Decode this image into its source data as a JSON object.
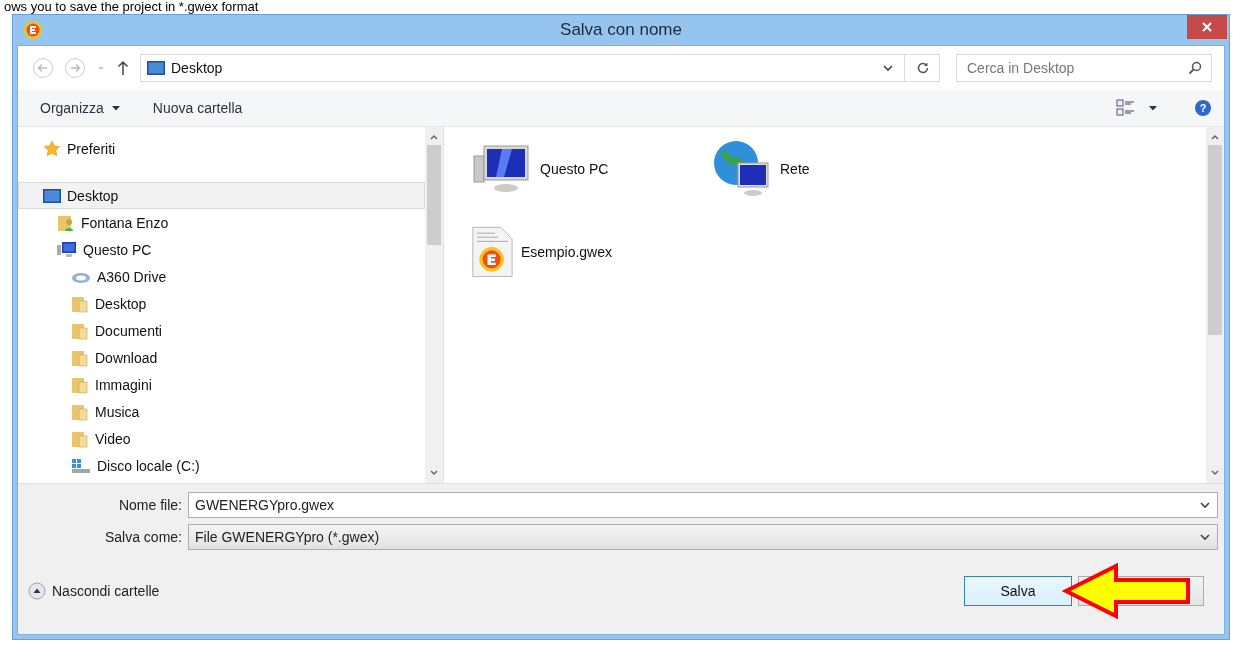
{
  "caption": "ows you to save the project in *.gwex format",
  "window": {
    "title": "Salva con nome"
  },
  "address_bar": {
    "path": "Desktop"
  },
  "search": {
    "placeholder": "Cerca in Desktop"
  },
  "toolbar": {
    "items": [
      "Organizza",
      "Nuova cartella"
    ],
    "help": "?"
  },
  "nav": {
    "items": [
      {
        "label": "Preferiti",
        "kind": "star",
        "selected": false
      },
      {
        "label": "Desktop",
        "kind": "desktop",
        "selected": true,
        "children": [
          {
            "label": "Fontana Enzo",
            "kind": "user",
            "selected": false
          },
          {
            "label": "Questo PC",
            "kind": "computer",
            "selected": false,
            "children": [
              {
                "label": "A360 Drive",
                "kind": "cloud",
                "selected": false
              },
              {
                "label": "Desktop",
                "kind": "folder",
                "selected": false
              },
              {
                "label": "Documenti",
                "kind": "folder",
                "selected": false
              },
              {
                "label": "Download",
                "kind": "folder",
                "selected": false
              },
              {
                "label": "Immagini",
                "kind": "folder",
                "selected": false
              },
              {
                "label": "Musica",
                "kind": "folder",
                "selected": false
              },
              {
                "label": "Video",
                "kind": "folder",
                "selected": false
              },
              {
                "label": "Disco locale (C:)",
                "kind": "drive",
                "selected": false
              }
            ]
          }
        ]
      }
    ]
  },
  "files": [
    {
      "name": "Questo PC",
      "kind": "computer"
    },
    {
      "name": "Rete",
      "kind": "network"
    },
    {
      "name": "Esempio.gwex",
      "kind": "document"
    }
  ],
  "form": {
    "file_name_label": "Nome file:",
    "file_name": "GWENERGYpro.gwex",
    "type_label": "Salva come:",
    "type": "File GWENERGYpro (*.gwex)"
  },
  "footer": {
    "toggle": "Nascondi cartelle",
    "save": "Salva"
  }
}
